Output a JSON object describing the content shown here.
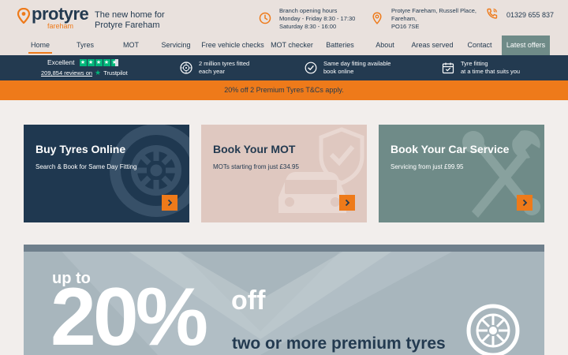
{
  "brand": {
    "name": "protyre",
    "location": "fareham",
    "tagline": "The new home for Protyre Fareham",
    "accent": "#ee7a1a",
    "navy": "#233a50"
  },
  "contact": {
    "hours_title": "Branch opening hours",
    "hours_weekdays": "Monday - Friday 8:30 - 17:30",
    "hours_saturday": "Saturday 8:30 - 16:00",
    "address_line1": "Protyre Fareham, Russell Place,",
    "address_line2": "Fareham,",
    "address_line3": "PO16 7SE",
    "phone": "01329 655 837"
  },
  "nav": {
    "items": [
      "Home",
      "Tyres",
      "MOT",
      "Servicing",
      "Free vehicle checks",
      "MOT checker",
      "Batteries",
      "About",
      "Areas served",
      "Contact",
      "Latest offers"
    ]
  },
  "trustpilot": {
    "rating_label": "Excellent",
    "reviews": "209,854 reviews on",
    "platform": "Trustpilot"
  },
  "features": [
    {
      "icon": "tyre-icon",
      "line1": "2 million tyres fitted",
      "line2": "each year"
    },
    {
      "icon": "check-circle-icon",
      "line1": "Same day fitting available",
      "line2": "book online"
    },
    {
      "icon": "calendar-icon",
      "line1": "Tyre fitting",
      "line2": "at a time that suits you"
    }
  ],
  "promo_strip": "20% off 2 Premium Tyres T&Cs apply.",
  "cards": [
    {
      "title": "Buy Tyres Online",
      "subtitle": "Search & Book for Same Day Fitting",
      "icon": "tyre-icon"
    },
    {
      "title": "Book Your MOT",
      "subtitle": "MOTs starting from just £34.95",
      "icon": "car-shield-icon"
    },
    {
      "title": "Book Your Car Service",
      "subtitle": "Servicing from just £99.95",
      "icon": "spanner-icon"
    }
  ],
  "hero": {
    "up_to": "up to",
    "percent": "20%",
    "off": "off",
    "line": "two or more premium tyres"
  }
}
